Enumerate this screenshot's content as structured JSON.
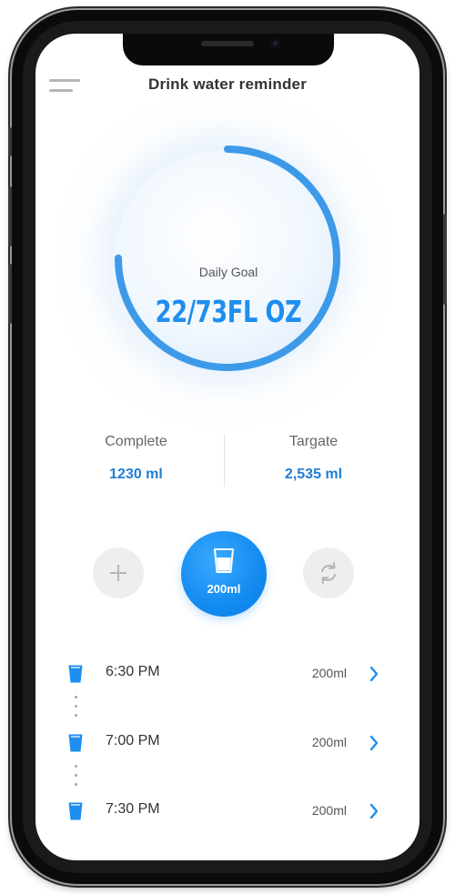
{
  "header": {
    "title": "Drink water reminder"
  },
  "icons": {
    "menu": "menu-icon",
    "add": "plus-icon",
    "refresh": "refresh-icon",
    "cup": "water-cup-icon",
    "chevron": "chevron-right-icon"
  },
  "colors": {
    "accent": "#1e8ef0",
    "progress_ring": "#3d9ae8",
    "stat_value": "#1f7fd6",
    "button_gray": "#eeeeee"
  },
  "goal": {
    "label": "Daily Goal",
    "value": "22/73FL OZ",
    "progress": 0.75
  },
  "stats": {
    "complete": {
      "label": "Complete",
      "value": "1230 ml"
    },
    "target": {
      "label": "Targate",
      "value": "2,535 ml"
    }
  },
  "drink_button": {
    "amount": "200ml"
  },
  "log": [
    {
      "time": "6:30 PM",
      "amount": "200ml"
    },
    {
      "time": "7:00 PM",
      "amount": "200ml"
    },
    {
      "time": "7:30 PM",
      "amount": "200ml"
    }
  ]
}
